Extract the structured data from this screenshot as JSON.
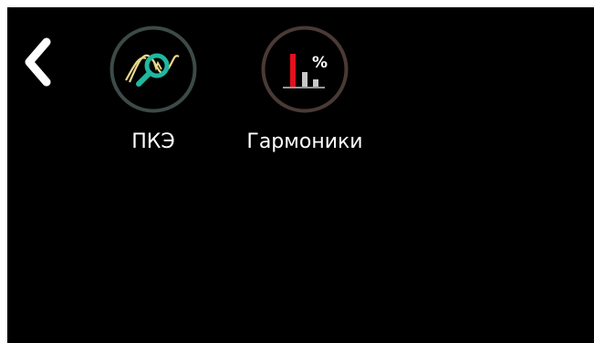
{
  "back": {
    "icon": "chevron-left-icon",
    "color": "#ffffff"
  },
  "tiles": [
    {
      "id": "pke",
      "label": "ПКЭ",
      "icon": "power-quality-search-icon",
      "ring_color": "#3c4a48",
      "accent_color": "#1fb89f",
      "wave_color": "#e8d88a"
    },
    {
      "id": "harmonics",
      "label": "Гармоники",
      "icon": "harmonics-bar-percent-icon",
      "ring_color": "#4a3a36",
      "accent_color": "#e3101c",
      "bar_color": "#c8c8c8"
    }
  ]
}
